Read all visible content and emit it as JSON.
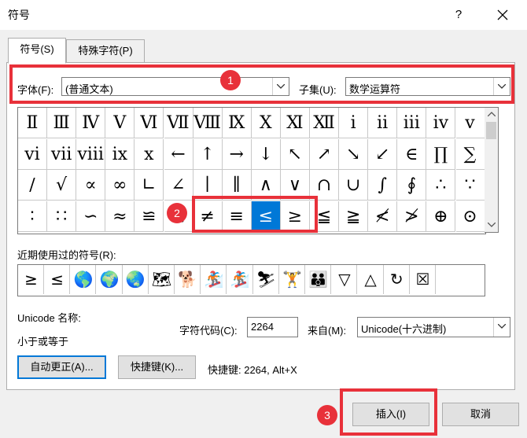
{
  "window": {
    "title": "符号",
    "help": "?"
  },
  "tabs": [
    {
      "label": "符号(S)",
      "active": true
    },
    {
      "label": "特殊字符(P)",
      "active": false
    }
  ],
  "font": {
    "label": "字体(F):",
    "value": "(普通文本)"
  },
  "subset": {
    "label": "子集(U):",
    "value": "数学运算符"
  },
  "symbols": [
    [
      "Ⅱ",
      "Ⅲ",
      "Ⅳ",
      "Ⅴ",
      "Ⅵ",
      "Ⅶ",
      "Ⅷ",
      "Ⅸ",
      "Ⅹ",
      "Ⅺ",
      "Ⅻ",
      "ⅰ",
      "ⅱ",
      "ⅲ",
      "ⅳ",
      "ⅴ"
    ],
    [
      "ⅵ",
      "ⅶ",
      "ⅷ",
      "ⅸ",
      "ⅹ",
      "←",
      "↑",
      "→",
      "↓",
      "↖",
      "↗",
      "↘",
      "↙",
      "∈",
      "∏",
      "∑"
    ],
    [
      "∕",
      "√",
      "∝",
      "∞",
      "∟",
      "∠",
      "∣",
      "∥",
      "∧",
      "∨",
      "∩",
      "∪",
      "∫",
      "∮",
      "∴",
      "∵"
    ],
    [
      "∶",
      "∷",
      "∽",
      "≈",
      "≌",
      "≒",
      "≠",
      "≡",
      "≤",
      "≥",
      "≦",
      "≧",
      "≮",
      "≯",
      "⊕",
      "⊙"
    ]
  ],
  "selected_symbol": {
    "row": 3,
    "col": 8
  },
  "recent": {
    "label": "近期使用过的符号(R):",
    "items": [
      "≥",
      "≤",
      "🌎",
      "🌍",
      "🌏",
      "🗺",
      "🐕",
      "🏂",
      "🏂",
      "⛷",
      "🏋",
      "👪",
      "▽",
      "△",
      "↻",
      "☒"
    ]
  },
  "unicode": {
    "label": "Unicode 名称:",
    "name": "小于或等于"
  },
  "char_code": {
    "label": "字符代码(C):",
    "value": "2264"
  },
  "from": {
    "label": "来自(M):",
    "value": "Unicode(十六进制)"
  },
  "buttons": {
    "autocorrect": "自动更正(A)...",
    "shortcut_key": "快捷键(K)...",
    "shortcut_text": "快捷键: 2264, Alt+X",
    "insert": "插入(I)",
    "cancel": "取消"
  },
  "annotations": {
    "badge1": "1",
    "badge2": "2",
    "badge3": "3",
    "color": "#e8313a"
  }
}
